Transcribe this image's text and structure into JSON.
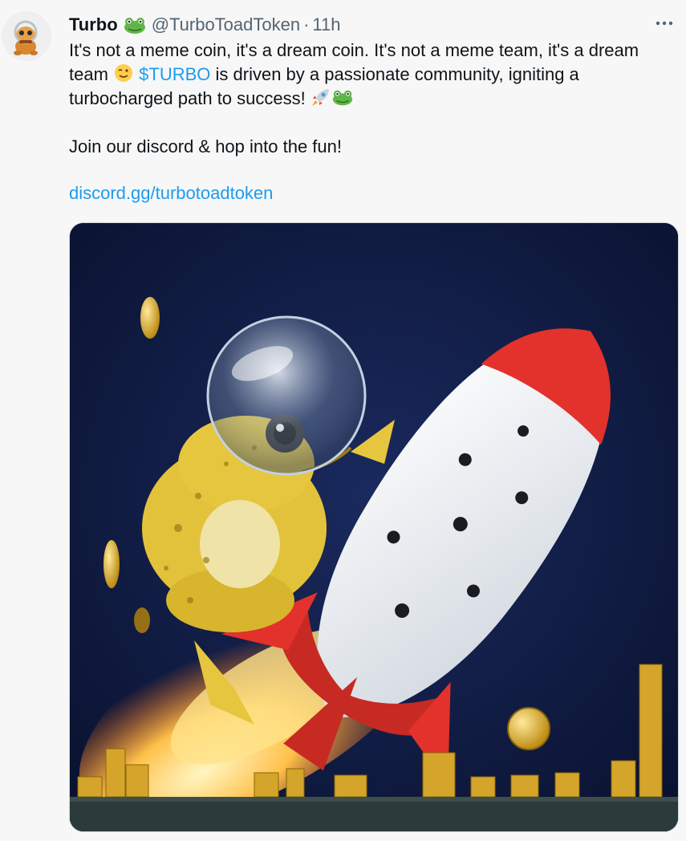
{
  "tweet": {
    "display_name": "Turbo",
    "handle": "@TurboToadToken",
    "separator": "·",
    "time": "11h",
    "text_line1_before_emoji": "It's not a meme coin, it's a dream coin. It's not a meme team, it's a dream team ",
    "cashtag": "$TURBO",
    "text_line1_after_cashtag": " is driven by a passionate community, igniting a turbocharged path to success! ",
    "text_line2": "Join our discord & hop into the fun!",
    "link": "discord.gg/turbotoadtoken"
  },
  "icons": {
    "badge": "frog-face-icon",
    "wink": "winking-face-icon",
    "rocket": "rocket-icon",
    "frog": "frog-face-icon",
    "more": "more-options-icon"
  },
  "colors": {
    "background": "#f7f7f7",
    "text": "#0f1419",
    "secondary": "#536471",
    "link": "#1d9bf0"
  }
}
